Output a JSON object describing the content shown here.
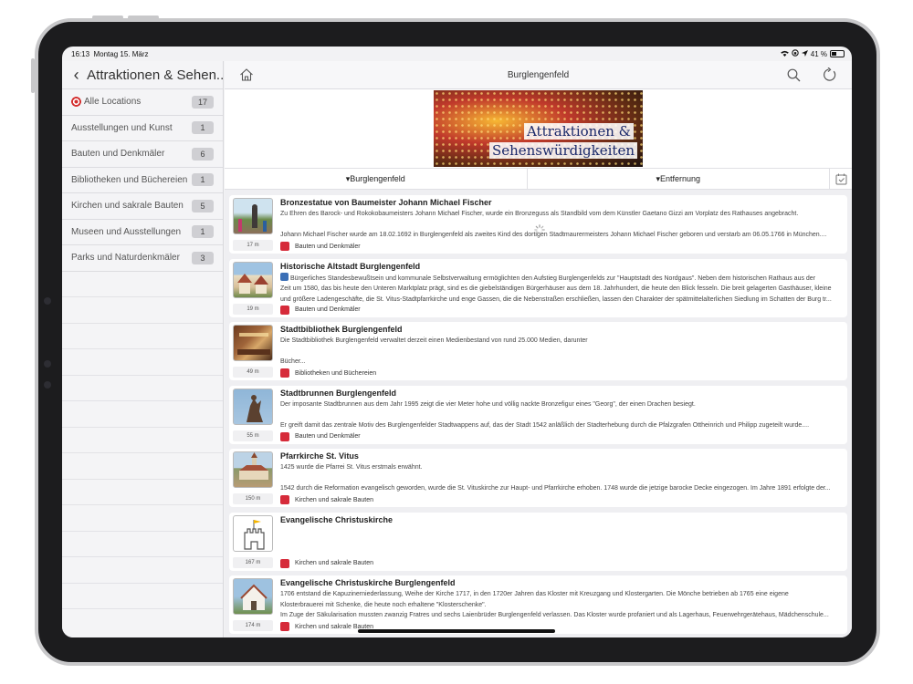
{
  "status": {
    "time": "16:13",
    "date": "Montag 15. März",
    "battery": "41 %"
  },
  "sidebar": {
    "title": "Attraktionen & Sehen...",
    "items": [
      {
        "label": "Alle Locations",
        "count": "17"
      },
      {
        "label": "Ausstellungen und Kunst",
        "count": "1"
      },
      {
        "label": "Bauten und Denkmäler",
        "count": "6"
      },
      {
        "label": "Bibliotheken und Büchereien",
        "count": "1"
      },
      {
        "label": "Kirchen und sakrale Bauten",
        "count": "5"
      },
      {
        "label": "Museen und Ausstellungen",
        "count": "1"
      },
      {
        "label": "Parks und Naturdenkmäler",
        "count": "3"
      }
    ]
  },
  "header": {
    "title": "Burglengenfeld"
  },
  "banner": {
    "line1": "Attraktionen &",
    "line2": "Sehenswürdigkeiten"
  },
  "filters": {
    "location": "▾Burglengenfeld",
    "sort": "▾Entfernung"
  },
  "cards": [
    {
      "title": "Bronzestatue von Baumeister Johann Michael Fischer",
      "line1": "Zu Ehren des Barock- und Rokokobaumeisters Johann Michael Fischer, wurde ein Bronzeguss als Standbild vom dem Künstler Gaetano Gizzi am Vorplatz des Rathauses angebracht.",
      "line2": "",
      "line3": "Johann Michael Fischer wurde am 18.02.1692 in Burglengenfeld als zweites Kind des dortigen Stadtmaurermeisters Johann Michael Fischer geboren und verstarb am 06.05.1766 in München....",
      "distance": "17 m",
      "category": "Bauten und Denkmäler"
    },
    {
      "title": "Historische Altstadt Burglengenfeld",
      "line1": "Bürgerliches Standesbewußtsein und kommunale Selbstverwaltung ermöglichten den Aufstieg Burglengenfelds zur \"Hauptstadt des Nordgaus\". Neben dem historischen Rathaus aus der",
      "line2": "Zeit um 1580, das bis heute den Unteren Marktplatz prägt, sind es die giebelständigen Bürgerhäuser aus dem 18. Jahrhundert, die heute den Blick fesseln. Die breit gelagerten Gasthäuser, kleine",
      "line3": "und größere Ladengeschäfte, die St. Vitus-Stadtpfarrkirche und enge Gassen, die die Nebenstraßen erschließen, lassen den Charakter der spätmittelalterlichen Siedlung im Schatten der Burg tr...",
      "distance": "19 m",
      "category": "Bauten und Denkmäler"
    },
    {
      "title": "Stadtbibliothek Burglengenfeld",
      "line1": "Die Stadtbibliothek Burglengenfeld verwaltet derzeit einen Medienbestand von rund 25.000 Medien, darunter",
      "line2": "",
      "line3": "Bücher...",
      "distance": "49 m",
      "category": "Bibliotheken und Büchereien"
    },
    {
      "title": "Stadtbrunnen Burglengenfeld",
      "line1": "Der imposante Stadtbrunnen aus dem Jahr 1995 zeigt die vier Meter hohe und völlig nackte Bronzefigur eines \"Georg\", der einen Drachen besiegt.",
      "line2": "",
      "line3": "Er greift damit das zentrale Motiv des Burglengenfelder Stadtwappens auf, das der Stadt 1542 anläßlich der Stadterhebung durch die Pfalzgrafen Ottheinrich und Philipp zugeteilt wurde....",
      "distance": "55 m",
      "category": "Bauten und Denkmäler"
    },
    {
      "title": "Pfarrkirche St. Vitus",
      "line1": "1425 wurde die Pfarrei St. Vitus erstmals erwähnt.",
      "line2": "",
      "line3": "1542 durch die Reformation evangelisch geworden, wurde die St. Vituskirche zur Haupt- und Pfarrkirche erhoben. 1748 wurde die jetzige barocke Decke eingezogen. Im Jahre 1891 erfolgte der...",
      "distance": "150 m",
      "category": "Kirchen und sakrale Bauten"
    },
    {
      "title": "Evangelische Christuskirche",
      "line1": "",
      "line2": "",
      "line3": "",
      "distance": "167 m",
      "category": "Kirchen und sakrale Bauten"
    },
    {
      "title": "Evangelische Christuskirche Burglengenfeld",
      "line1": "1706 entstand die Kapuzinerniederlassung, Weihe der Kirche 1717, in den 1720er Jahren das Kloster mit Kreuzgang und Klostergarten. Die Mönche betrieben ab 1765 eine eigene",
      "line2": "Klosterbrauerei mit Schenke, die heute noch erhaltene \"Klosterschenke\".",
      "line3": "Im Zuge der Säkularisation mussten zwanzig Fratres und sechs Laienbrüder Burglengenfeld verlassen. Das Kloster wurde profaniert und als Lagerhaus, Feuerwehrgerätehaus, Mädchenschule...",
      "distance": "174 m",
      "category": "Kirchen und sakrale Bauten"
    }
  ],
  "colors": {
    "category_marker": "#d62b3a",
    "badge": "#cfcfd3"
  }
}
